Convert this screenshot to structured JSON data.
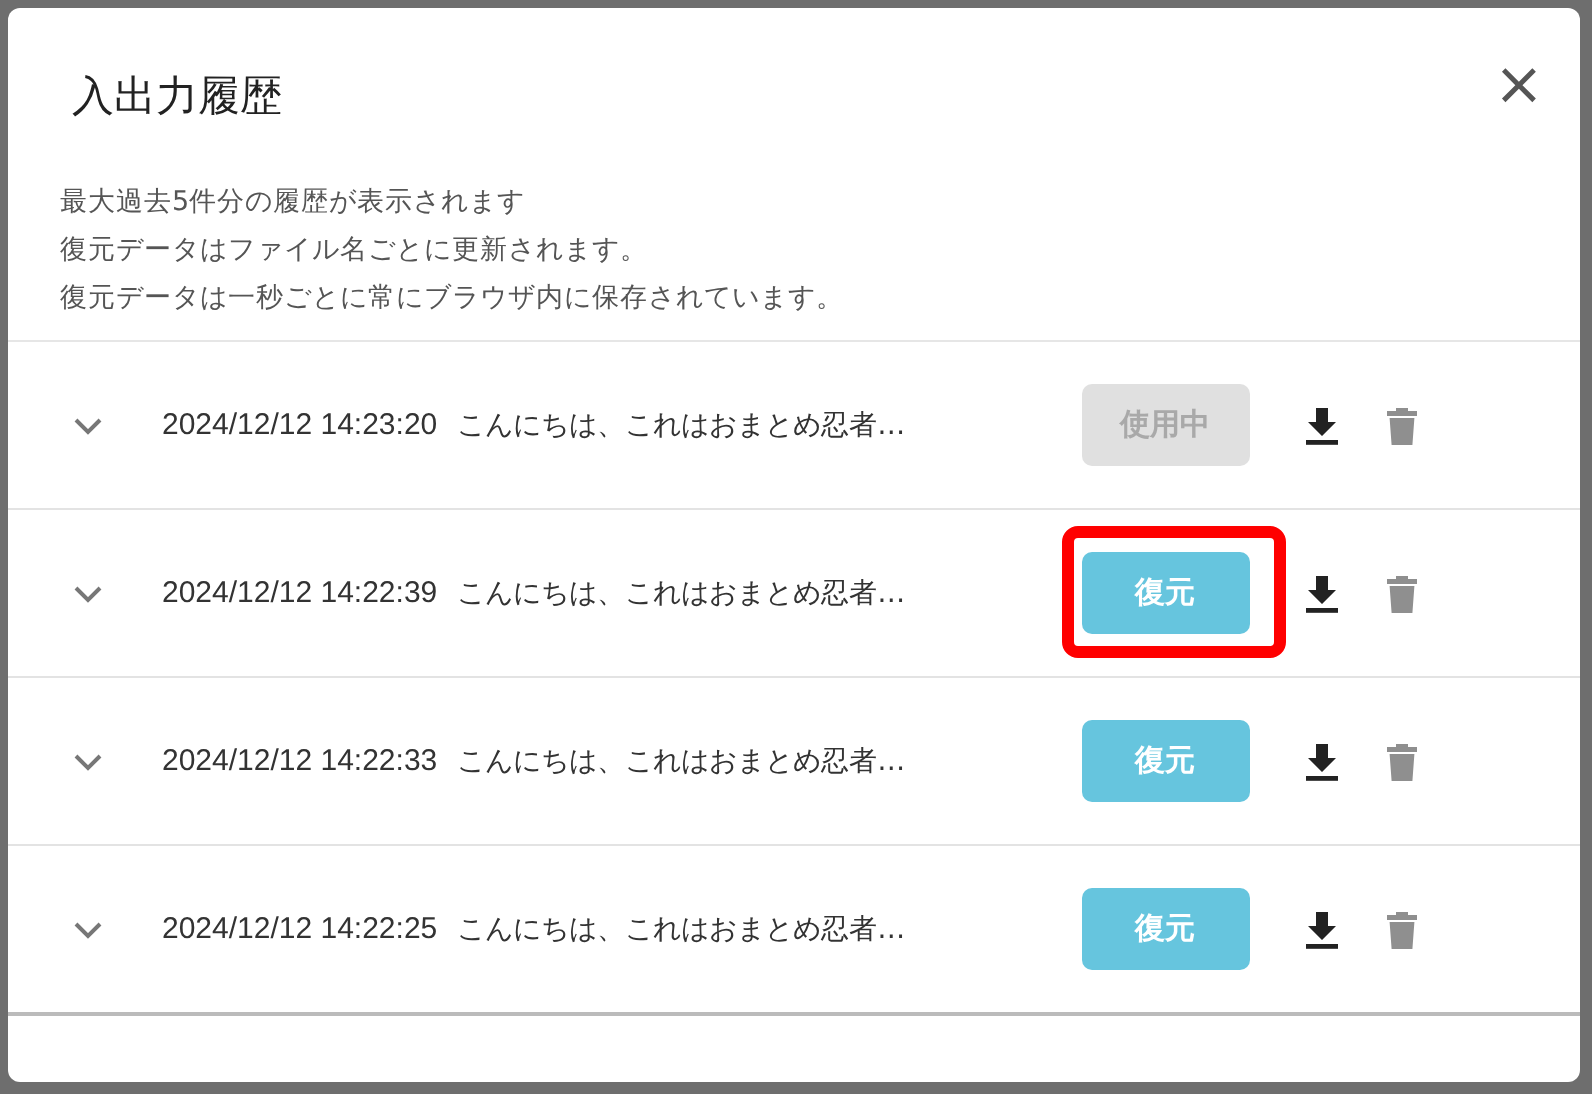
{
  "dialog": {
    "title": "入出力履歴",
    "close": "×",
    "notes": [
      "最大過去5件分の履歴が表示されます",
      "復元データはファイル名ごとに更新されます。",
      "復元データは一秒ごとに常にブラウザ内に保存されています。"
    ]
  },
  "entries": [
    {
      "timestamp": "2024/12/12 14:23:20",
      "summary": "こんにちは、これはおまとめ忍者…",
      "button": "使用中",
      "in_use": true,
      "highlighted": false
    },
    {
      "timestamp": "2024/12/12 14:22:39",
      "summary": "こんにちは、これはおまとめ忍者…",
      "button": "復元",
      "in_use": false,
      "highlighted": true
    },
    {
      "timestamp": "2024/12/12 14:22:33",
      "summary": "こんにちは、これはおまとめ忍者…",
      "button": "復元",
      "in_use": false,
      "highlighted": false
    },
    {
      "timestamp": "2024/12/12 14:22:25",
      "summary": "こんにちは、これはおまとめ忍者…",
      "button": "復元",
      "in_use": false,
      "highlighted": false
    }
  ]
}
